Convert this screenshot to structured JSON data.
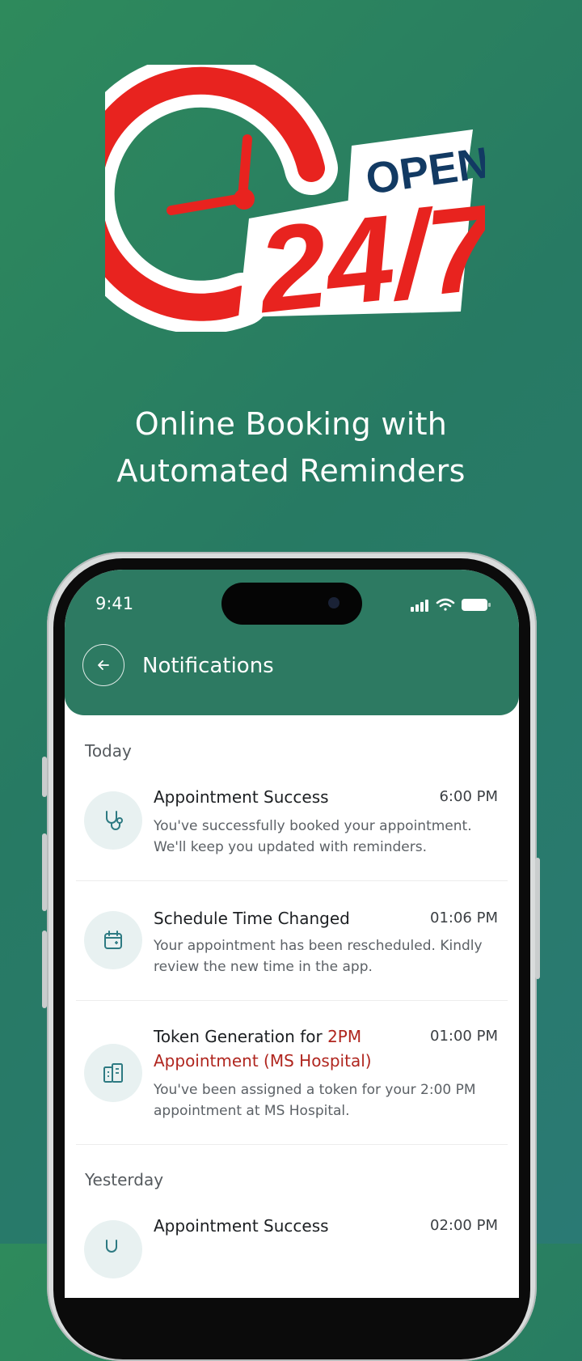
{
  "logo": {
    "top_text": "OPEN",
    "main_text": "24/7",
    "colors": {
      "red": "#e8231f",
      "navy": "#123a63"
    }
  },
  "headline": {
    "line1": "Online Booking with",
    "line2": "Automated Reminders"
  },
  "phone": {
    "status_bar": {
      "time": "9:41"
    },
    "header": {
      "title": "Notifications",
      "back_icon": "arrow-left-icon"
    },
    "sections": [
      {
        "label": "Today"
      },
      {
        "label": "Yesterday"
      }
    ],
    "notifications": [
      {
        "icon": "stethoscope-icon",
        "title": "Appointment Success",
        "title_accent": "",
        "time": "6:00 PM",
        "body": "You've successfully booked your appointment. We'll keep you updated with reminders."
      },
      {
        "icon": "calendar-icon",
        "title": "Schedule Time Changed",
        "title_accent": "",
        "time": "01:06 PM",
        "body": "Your appointment has been rescheduled. Kindly review the new time in the app."
      },
      {
        "icon": "hospital-building-icon",
        "title": "Token Generation for ",
        "title_accent": "2PM Appointment (MS Hospital)",
        "time": "01:00 PM",
        "body": "You've been assigned a token for your 2:00 PM appointment at MS Hospital."
      },
      {
        "icon": "stethoscope-icon",
        "title": "Appointment Success",
        "title_accent": "",
        "time": "02:00 PM",
        "body": ""
      }
    ],
    "colors": {
      "header_bg": "#2d7a62",
      "accent_text": "#b0261f"
    }
  }
}
